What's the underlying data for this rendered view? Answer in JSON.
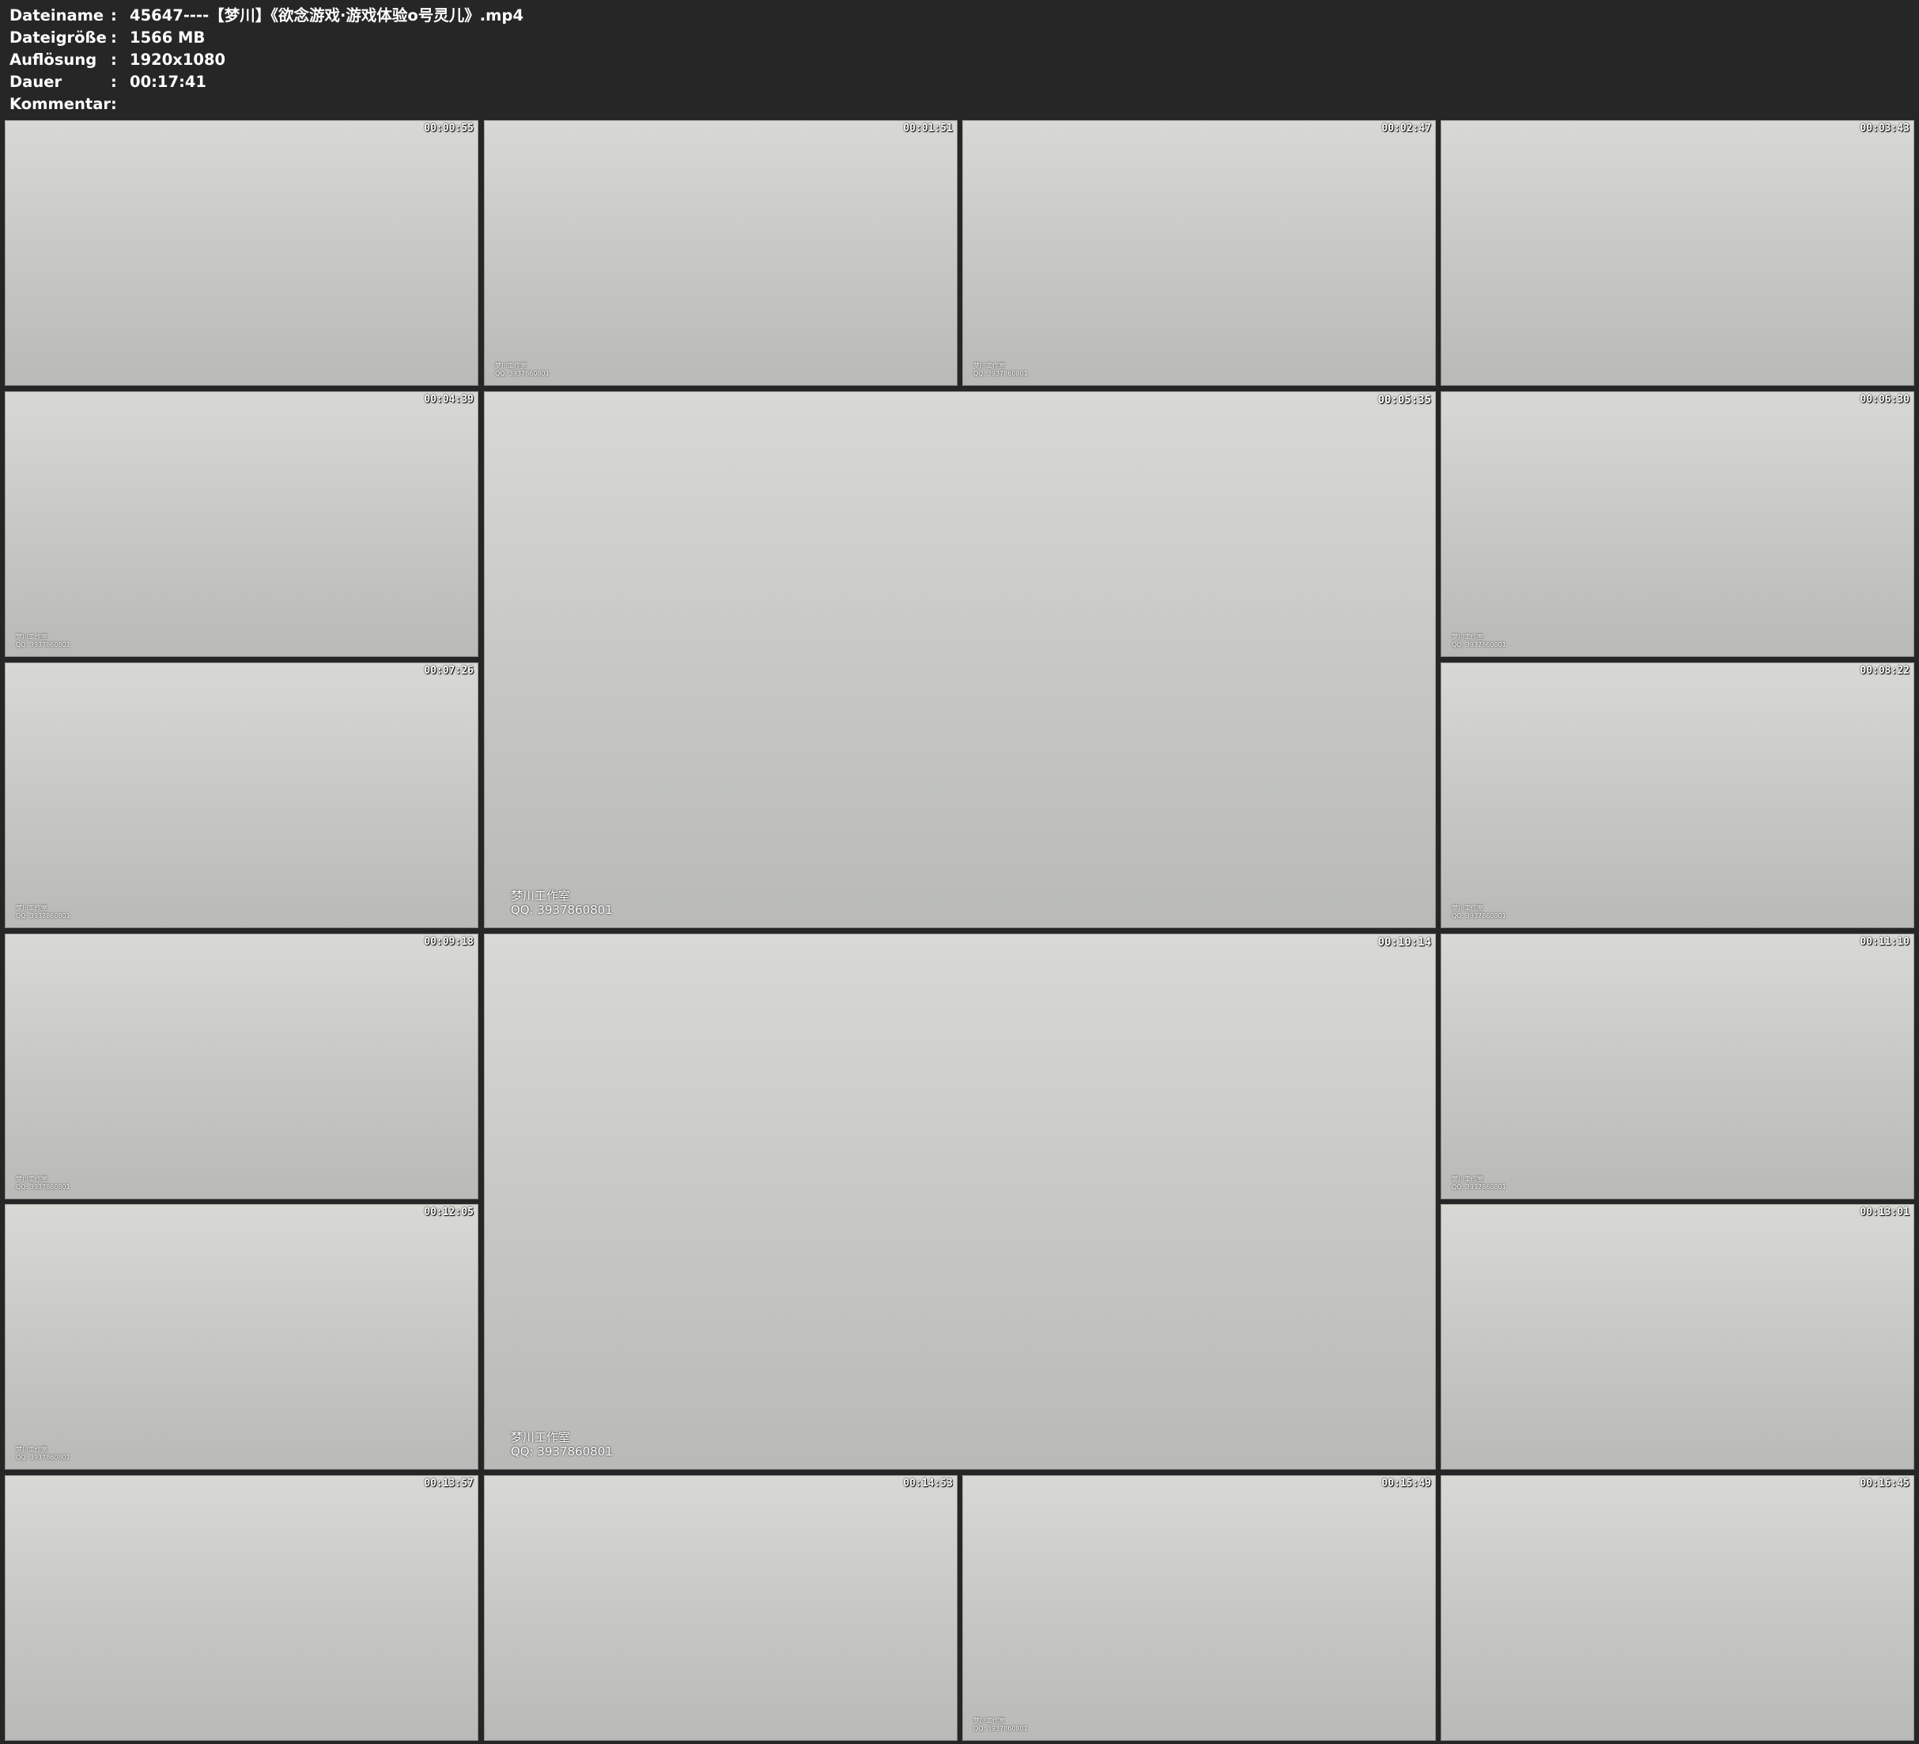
{
  "file_info": [
    {
      "label": "Dateiname",
      "value": "45647----【梦川】《欲念游戏·游戏体验o号灵儿》.mp4"
    },
    {
      "label": "Dateigröße",
      "value": "1566 MB"
    },
    {
      "label": "Auflösung",
      "value": "1920x1080"
    },
    {
      "label": "Dauer",
      "value": "00:17:41"
    },
    {
      "label": "Kommentar",
      "value": ""
    }
  ],
  "separator": ":",
  "thumbnails": [
    {
      "time": "00:00:55",
      "watermark": []
    },
    {
      "time": "00:01:51",
      "watermark": [
        "梦川工作室",
        "QQ: 3937860801"
      ]
    },
    {
      "time": "00:02:47",
      "watermark": [
        "梦川工作室",
        "QQ: 3937860801"
      ]
    },
    {
      "time": "00:03:43",
      "watermark": []
    },
    {
      "time": "00:04:39",
      "watermark": [
        "梦川工作室",
        "QQ: 3937860801"
      ]
    },
    {
      "time": "00:05:35",
      "watermark": [
        "梦川工作室",
        "QQ: 3937860801"
      ]
    },
    {
      "time": "00:06:30",
      "watermark": [
        "梦川工作室",
        "QQ: 3937860801"
      ]
    },
    {
      "time": "00:07:26",
      "watermark": [
        "梦川工作室",
        "QQ: 3937860801"
      ]
    },
    {
      "time": "00:08:22",
      "watermark": [
        "梦川工作室",
        "QQ: 3937860801"
      ]
    },
    {
      "time": "00:09:18",
      "watermark": [
        "梦川工作室",
        "QQ: 3937860801"
      ]
    },
    {
      "time": "00:10:14",
      "watermark": [
        "梦川工作室",
        "QQ: 3937860801"
      ]
    },
    {
      "time": "00:11:10",
      "watermark": [
        "梦川工作室",
        "QQ: 3937860801"
      ]
    },
    {
      "time": "00:12:05",
      "watermark": [
        "梦川工作室",
        "QQ: 3937860801"
      ]
    },
    {
      "time": "00:13:01",
      "watermark": []
    },
    {
      "time": "00:13:57",
      "watermark": []
    },
    {
      "time": "00:14:53",
      "watermark": []
    },
    {
      "time": "00:15:49",
      "watermark": [
        "梦川工作室",
        "QQ: 3937860801"
      ]
    },
    {
      "time": "00:16:45",
      "watermark": []
    }
  ]
}
